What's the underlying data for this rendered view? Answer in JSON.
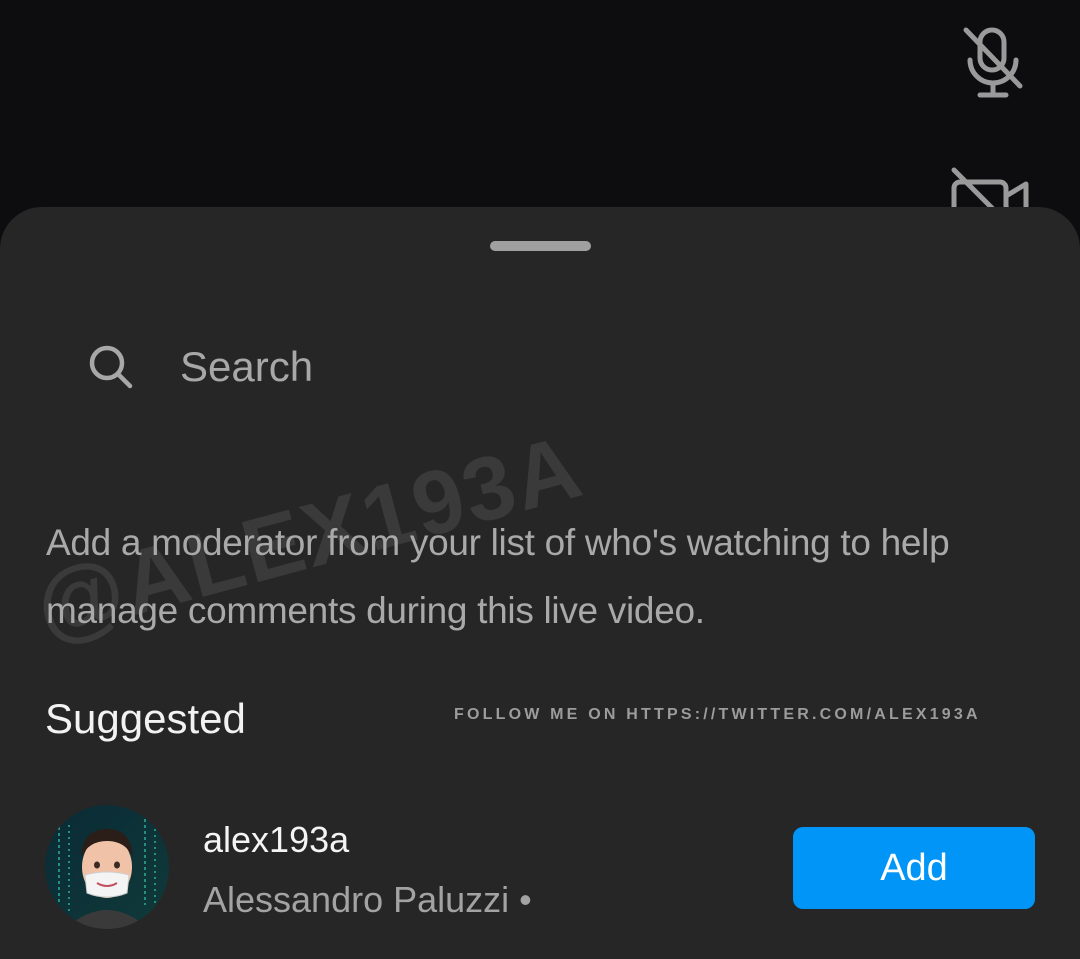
{
  "top_controls": {
    "mic_icon": "mic-muted-icon",
    "camera_icon": "camera-off-icon"
  },
  "sheet": {
    "search": {
      "placeholder": "Search",
      "value": "",
      "icon": "search-icon"
    },
    "description": "Add a moderator from your list of who's watching to help manage comments during this live video.",
    "watermark": "@ALEX193A",
    "section_title": "Suggested",
    "follow_note": "FOLLOW ME ON HTTPS://TWITTER.COM/ALEX193A",
    "users": [
      {
        "username": "alex193a",
        "full_name": "Alessandro Paluzzi •",
        "button_label": "Add"
      }
    ]
  },
  "colors": {
    "background": "#0d0c0f",
    "sheet": "#262626",
    "accent": "#0095f6",
    "muted_text": "#a9a9a9"
  }
}
